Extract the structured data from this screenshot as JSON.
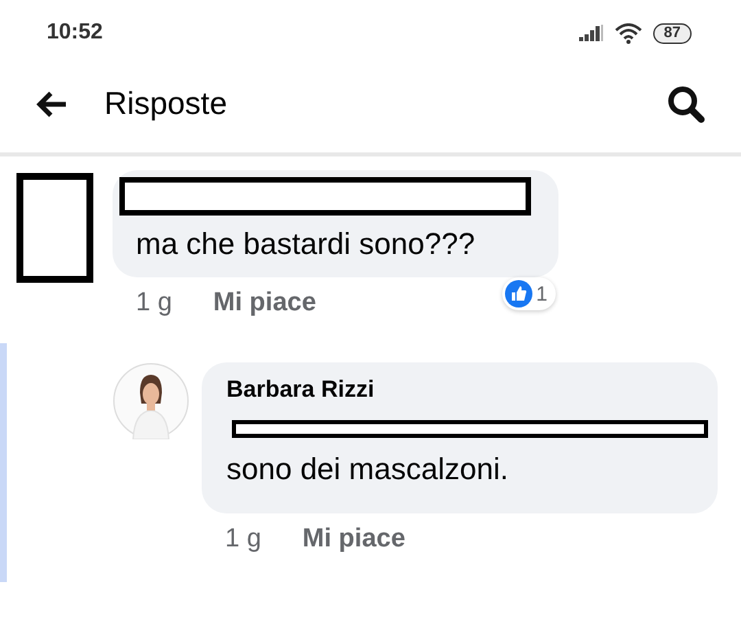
{
  "status_bar": {
    "time": "10:52",
    "battery": "87"
  },
  "header": {
    "title": "Risposte"
  },
  "comments": [
    {
      "avatar_redacted": true,
      "name_redacted": true,
      "text": "ma che bastardi sono???",
      "time": "1 g",
      "like": "Mi piace",
      "reaction_count": "1",
      "reply": false
    },
    {
      "avatar_redacted": false,
      "name": "Barbara Rizzi",
      "mention_redacted": true,
      "text": "sono dei mascalzoni.",
      "time": "1 g",
      "like": "Mi piace",
      "reply": true
    }
  ]
}
